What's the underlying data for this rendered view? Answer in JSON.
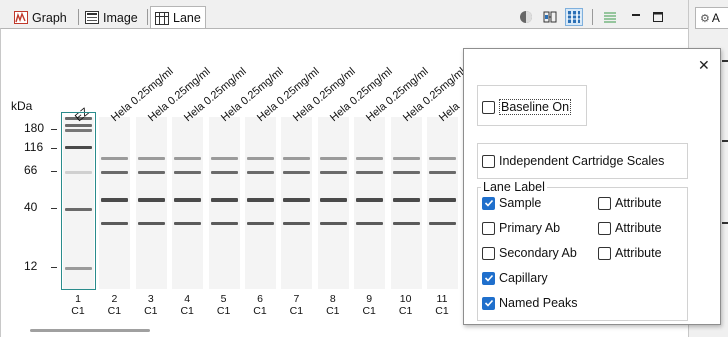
{
  "tabs": [
    {
      "label": "Graph",
      "icon": "graph-icon"
    },
    {
      "label": "Image",
      "icon": "image-icon"
    },
    {
      "label": "Lane",
      "icon": "lane-icon",
      "active": true
    }
  ],
  "right_tab": {
    "label": "A"
  },
  "toolbar": {
    "icons": [
      "circle-toggle-icon",
      "fit-icon",
      "lane-view-icon",
      "stacked-lines-icon",
      "minimize-icon",
      "maximize-icon"
    ],
    "selected": "lane-view-icon"
  },
  "lane_view": {
    "unit_label": "kDa",
    "mw_markers": [
      "180",
      "116",
      "66",
      "40",
      "12"
    ],
    "ladder_label": "EZ",
    "lanes": [
      {
        "number": "1",
        "capillary": "C1",
        "sample": "EZ"
      },
      {
        "number": "2",
        "capillary": "C1",
        "sample": "Hela 0.25mg/ml"
      },
      {
        "number": "3",
        "capillary": "C1",
        "sample": "Hela 0.25mg/ml"
      },
      {
        "number": "4",
        "capillary": "C1",
        "sample": "Hela 0.25mg/ml"
      },
      {
        "number": "5",
        "capillary": "C1",
        "sample": "Hela 0.25mg/ml"
      },
      {
        "number": "6",
        "capillary": "C1",
        "sample": "Hela 0.25mg/ml"
      },
      {
        "number": "7",
        "capillary": "C1",
        "sample": "Hela 0.25mg/ml"
      },
      {
        "number": "8",
        "capillary": "C1",
        "sample": "Hela 0.25mg/ml"
      },
      {
        "number": "9",
        "capillary": "C1",
        "sample": "Hela 0.25mg/ml"
      },
      {
        "number": "10",
        "capillary": "C1",
        "sample": "Hela 0.25mg/ml"
      },
      {
        "number": "11",
        "capillary": "C1",
        "sample": "Hela"
      }
    ],
    "colors": {
      "band": "#7a7a7a",
      "ladder_highlight": "#2a8c8c"
    }
  },
  "settings_popup": {
    "close_label": "✕",
    "baseline": {
      "label": "Baseline On",
      "checked": false
    },
    "independent_scales": {
      "label": "Independent Cartridge Scales",
      "checked": false
    },
    "lane_label": {
      "title": "Lane Label",
      "options": [
        {
          "label": "Sample",
          "checked": true
        },
        {
          "label": "Primary Ab",
          "checked": false
        },
        {
          "label": "Secondary Ab",
          "checked": false
        },
        {
          "label": "Capillary",
          "checked": true
        },
        {
          "label": "Named Peaks",
          "checked": true
        }
      ],
      "attributes": [
        {
          "label": "Attribute",
          "checked": false
        },
        {
          "label": "Attribute",
          "checked": false
        },
        {
          "label": "Attribute",
          "checked": false
        }
      ]
    },
    "accent_color": "#1f6fcc"
  }
}
